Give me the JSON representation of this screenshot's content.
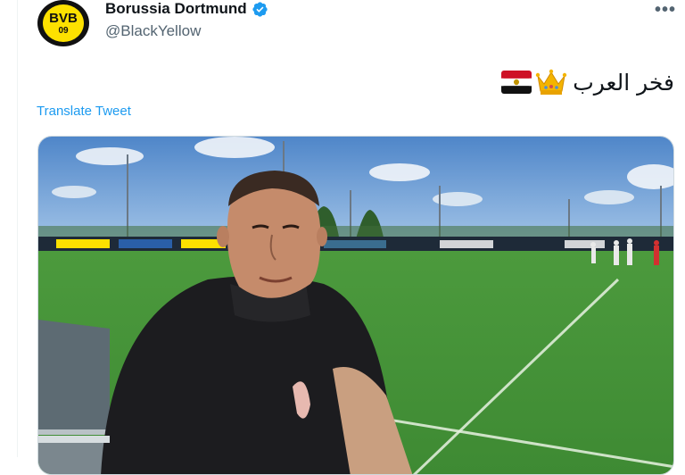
{
  "author": {
    "display_name": "Borussia Dortmund",
    "handle": "@BlackYellow",
    "verified": true,
    "avatar_text": "BVB",
    "avatar_number": "09",
    "brand_colors": {
      "yellow": "#fde100",
      "black": "#111111"
    }
  },
  "tweet": {
    "text": "فخر العرب",
    "emojis": [
      "flag-egypt-icon",
      "crown-icon"
    ],
    "translate_label": "Translate Tweet"
  },
  "colors": {
    "text_primary": "#0f1419",
    "text_secondary": "#536471",
    "link": "#1d9bf0",
    "verified": "#1d9bf0"
  },
  "media": {
    "type": "video"
  }
}
